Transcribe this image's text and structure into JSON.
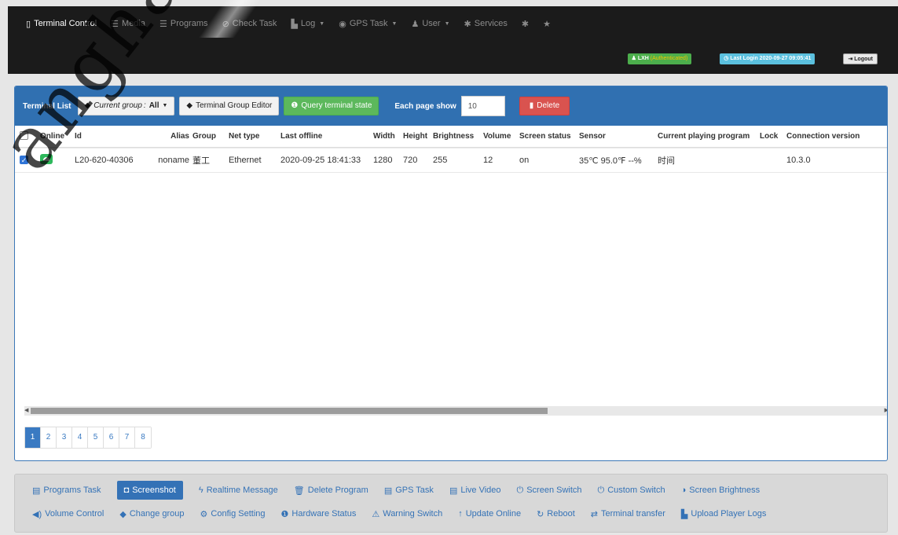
{
  "nav": {
    "items": [
      {
        "label": "Terminal Control",
        "icon": "tablet-icon",
        "glyph": "▯",
        "active": true,
        "dropdown": false
      },
      {
        "label": "Media",
        "icon": "media-icon",
        "glyph": "☰",
        "active": false,
        "dropdown": false
      },
      {
        "label": "Programs",
        "icon": "programs-icon",
        "glyph": "☰",
        "active": false,
        "dropdown": false
      },
      {
        "label": "Check Task",
        "icon": "check-circle-icon",
        "glyph": "⊘",
        "active": false,
        "dropdown": false
      },
      {
        "label": "Log",
        "icon": "file-icon",
        "glyph": "▙",
        "active": false,
        "dropdown": true
      },
      {
        "label": "GPS Task",
        "icon": "globe-icon",
        "glyph": "◉",
        "active": false,
        "dropdown": true
      },
      {
        "label": "User",
        "icon": "user-icon",
        "glyph": "♟",
        "active": false,
        "dropdown": true
      },
      {
        "label": "Services",
        "icon": "asterisk-icon",
        "glyph": "✱",
        "active": false,
        "dropdown": false
      },
      {
        "label": "",
        "icon": "asterisk-icon",
        "glyph": "✱",
        "active": false,
        "dropdown": false
      },
      {
        "label": "",
        "icon": "star-icon",
        "glyph": "★",
        "active": false,
        "dropdown": false
      }
    ],
    "user": {
      "name": "LXH",
      "auth": "(Authenticated)"
    },
    "last_login": "Last Login 2020-09-27 09:05:41",
    "logout": "Logout"
  },
  "toolbar": {
    "title": "Terminal List",
    "group_label": "Current group :",
    "group_value": "All",
    "group_editor": "Terminal Group Editor",
    "query": "Query terminal state",
    "each_page": "Each page show",
    "page_size": "10",
    "delete": "Delete"
  },
  "table": {
    "headers": [
      "Online",
      "Id",
      "Alias",
      "Group",
      "Net type",
      "Last offline",
      "Width",
      "Height",
      "Brightness",
      "Volume",
      "Screen status",
      "Sensor",
      "Current playing program",
      "Lock",
      "Connection version"
    ],
    "rows": [
      {
        "checked": true,
        "online": true,
        "id": "L20-620-40306",
        "alias": "noname",
        "group": "董工",
        "net_type": "Ethernet",
        "last_offline": "2020-09-25 18:41:33",
        "width": "1280",
        "height": "720",
        "brightness": "255",
        "volume": "12",
        "screen_status": "on",
        "sensor": "35℃ 95.0℉ --%",
        "program": "时间",
        "lock": "",
        "version": "10.3.0"
      }
    ]
  },
  "pagination": {
    "pages": [
      "1",
      "2",
      "3",
      "4",
      "5",
      "6",
      "7",
      "8"
    ],
    "current": "1"
  },
  "actions": {
    "row1": [
      {
        "label": "Programs Task",
        "icon": "film-icon",
        "glyph": "▤",
        "active": false
      },
      {
        "label": "Screenshot",
        "icon": "camera-icon",
        "glyph": "◘",
        "active": true
      },
      {
        "label": "Realtime Message",
        "icon": "flash-icon",
        "glyph": "ϟ",
        "active": false
      },
      {
        "label": "Delete Program",
        "icon": "trash-icon",
        "glyph": "🗑",
        "active": false
      },
      {
        "label": "GPS Task",
        "icon": "film-icon",
        "glyph": "▤",
        "active": false
      },
      {
        "label": "Live Video",
        "icon": "film-icon",
        "glyph": "▤",
        "active": false
      },
      {
        "label": "Screen Switch",
        "icon": "power-icon",
        "glyph": "⏻",
        "active": false
      },
      {
        "label": "Custom Switch",
        "icon": "power-icon",
        "glyph": "⏻",
        "active": false
      },
      {
        "label": "Screen Brightness",
        "icon": "adjust-icon",
        "glyph": "◑",
        "active": false
      }
    ],
    "row2": [
      {
        "label": "Volume Control",
        "icon": "volume-icon",
        "glyph": "◀)",
        "active": false
      },
      {
        "label": "Change group",
        "icon": "tag-icon",
        "glyph": "◆",
        "active": false
      },
      {
        "label": "Config Setting",
        "icon": "cog-icon",
        "glyph": "⚙",
        "active": false
      },
      {
        "label": "Hardware Status",
        "icon": "info-icon",
        "glyph": "❶",
        "active": false
      },
      {
        "label": "Warning Switch",
        "icon": "warning-icon",
        "glyph": "⚠",
        "active": false
      },
      {
        "label": "Update Online",
        "icon": "arrow-up-icon",
        "glyph": "↑",
        "active": false
      },
      {
        "label": "Reboot",
        "icon": "refresh-icon",
        "glyph": "↻",
        "active": false
      },
      {
        "label": "Terminal transfer",
        "icon": "transfer-icon",
        "glyph": "⇄",
        "active": false
      },
      {
        "label": "Upload Player Logs",
        "icon": "file-icon",
        "glyph": "▙",
        "active": false
      }
    ]
  },
  "watermark": "anghai Xixun",
  "colors": {
    "primary": "#3070b1",
    "success": "#5cb85c",
    "danger": "#d9534f",
    "nav_bg": "#1b1b1b",
    "link": "#3472b6"
  }
}
